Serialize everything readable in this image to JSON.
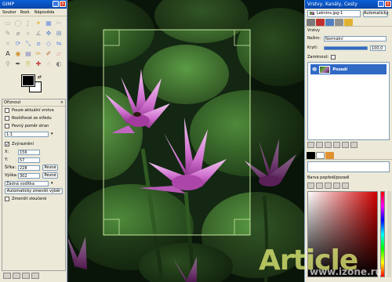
{
  "toolbox": {
    "title": "GIMP",
    "menu": [
      "Soubor",
      "Rozš.",
      "Nápověda"
    ],
    "tools": [
      {
        "icon": "rect-select-icon",
        "glyph": "▭",
        "color": "#b0b0b0"
      },
      {
        "icon": "ellipse-select-icon",
        "glyph": "◯",
        "color": "#b0b0b0"
      },
      {
        "icon": "free-select-icon",
        "glyph": "ʆ",
        "color": "#c0c0c0"
      },
      {
        "icon": "fuzzy-select-icon",
        "glyph": "✦",
        "color": "#e0c040"
      },
      {
        "icon": "color-select-icon",
        "glyph": "▦",
        "color": "#7090e0"
      },
      {
        "icon": "scissors-icon",
        "glyph": "✂",
        "color": "#c0c0c0"
      },
      {
        "icon": "paths-icon",
        "glyph": "✎",
        "color": "#a0a0a0"
      },
      {
        "icon": "color-picker-icon",
        "glyph": "⌀",
        "color": "#909090"
      },
      {
        "icon": "zoom-icon",
        "glyph": "⌕",
        "color": "#a0a0a0"
      },
      {
        "icon": "measure-icon",
        "glyph": "∡",
        "color": "#a0a0a0"
      },
      {
        "icon": "move-icon",
        "glyph": "✥",
        "color": "#7090c0"
      },
      {
        "icon": "align-icon",
        "glyph": "⊞",
        "color": "#7090c0"
      },
      {
        "icon": "crop-icon",
        "glyph": "⌗",
        "color": "#b0b0b0"
      },
      {
        "icon": "rotate-icon",
        "glyph": "⟳",
        "color": "#7090e0"
      },
      {
        "icon": "scale-icon",
        "glyph": "⤡",
        "color": "#7090e0"
      },
      {
        "icon": "shear-icon",
        "glyph": "⧄",
        "color": "#7090e0"
      },
      {
        "icon": "perspective-icon",
        "glyph": "◇",
        "color": "#7090e0"
      },
      {
        "icon": "flip-icon",
        "glyph": "⇋",
        "color": "#7090e0"
      },
      {
        "icon": "text-icon",
        "glyph": "A",
        "color": "#303030"
      },
      {
        "icon": "bucket-fill-icon",
        "glyph": "◉",
        "color": "#d09030"
      },
      {
        "icon": "blend-icon",
        "glyph": "▤",
        "color": "#8080c0"
      },
      {
        "icon": "pencil-icon",
        "glyph": "✏",
        "color": "#d0a040"
      },
      {
        "icon": "paintbrush-icon",
        "glyph": "✐",
        "color": "#c06030"
      },
      {
        "icon": "eraser-icon",
        "glyph": "▱",
        "color": "#e090a0"
      },
      {
        "icon": "airbrush-icon",
        "glyph": "⚲",
        "color": "#a0a0a0"
      },
      {
        "icon": "ink-icon",
        "glyph": "✒",
        "color": "#404040"
      },
      {
        "icon": "clone-icon",
        "glyph": "⎘",
        "color": "#c0c040"
      },
      {
        "icon": "heal-icon",
        "glyph": "✚",
        "color": "#c04040"
      },
      {
        "icon": "smudge-icon",
        "glyph": "☝",
        "color": "#d0a080"
      },
      {
        "icon": "dodge-burn-icon",
        "glyph": "◐",
        "color": "#808080"
      }
    ],
    "options": {
      "title": "Ořiznout",
      "only_current_layer": "Pouze aktuální vrstva",
      "expand_from_center": "Rozšiřovat ze středu",
      "fixed_aspect": "Pevný poměr stran",
      "ratio": "1:1",
      "highlight": "Zvýraznění",
      "x_label": "X:",
      "x_value": "156",
      "y_label": "Y:",
      "y_value": "57",
      "width_label": "Šířka:",
      "width_value": "228",
      "height_label": "Výška:",
      "height_value": "302",
      "fixed_button": "Pevné",
      "guides": "Žádná vodítka",
      "auto_shrink": "Automaticky zmenšit výběr",
      "shrink_merged": "Zmenšit sloučené"
    }
  },
  "dock": {
    "title": "Vrstvy, Kanály, Cesty",
    "image_select": "Leknins.jpg-1",
    "auto_button": "Automaticky",
    "layers_label": "Vrstvy",
    "mode_label": "Režim:",
    "mode_value": "Normální",
    "opacity_label": "Krytí:",
    "opacity_value": "100,0",
    "lock_label": "Zamknout:",
    "layer_name": "Pozadí",
    "fg_bg_title": "Barva popředí/pozadí"
  },
  "watermark": {
    "text": "Article",
    "url": "www.izone.ru"
  }
}
